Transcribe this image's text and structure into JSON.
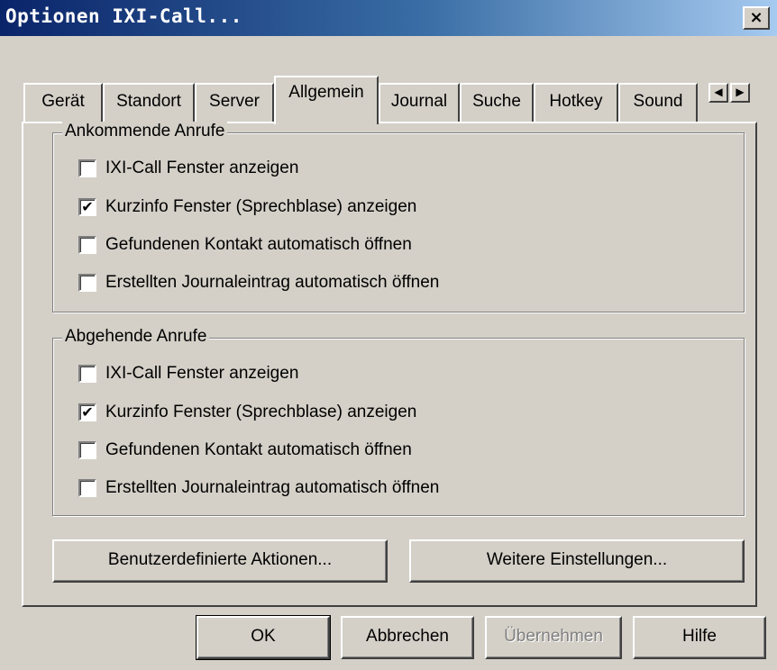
{
  "window": {
    "title": "Optionen IXI-Call..."
  },
  "tabs": [
    {
      "label": "Gerät"
    },
    {
      "label": "Standort"
    },
    {
      "label": "Server"
    },
    {
      "label": "Allgemein",
      "active": true
    },
    {
      "label": "Journal"
    },
    {
      "label": "Suche"
    },
    {
      "label": "Hotkey"
    },
    {
      "label": "Sound"
    }
  ],
  "incoming": {
    "title": "Ankommende Anrufe",
    "options": [
      {
        "label": "IXI-Call Fenster anzeigen",
        "checked": false
      },
      {
        "label": "Kurzinfo Fenster (Sprechblase) anzeigen",
        "checked": true
      },
      {
        "label": "Gefundenen Kontakt automatisch öffnen",
        "checked": false
      },
      {
        "label": "Erstellten Journaleintrag automatisch öffnen",
        "checked": false
      }
    ]
  },
  "outgoing": {
    "title": "Abgehende Anrufe",
    "options": [
      {
        "label": "IXI-Call Fenster anzeigen",
        "checked": false
      },
      {
        "label": "Kurzinfo Fenster (Sprechblase) anzeigen",
        "checked": true
      },
      {
        "label": "Gefundenen Kontakt automatisch öffnen",
        "checked": false
      },
      {
        "label": "Erstellten Journaleintrag automatisch öffnen",
        "checked": false
      }
    ]
  },
  "actions": {
    "custom_label": "Benutzerdefinierte Aktionen...",
    "more_label": "Weitere Einstellungen..."
  },
  "footer": {
    "ok": "OK",
    "cancel": "Abbrechen",
    "apply": "Übernehmen",
    "help": "Hilfe"
  },
  "glyphs": {
    "close": "×",
    "checked": "✔",
    "left": "◀",
    "right": "▶"
  }
}
